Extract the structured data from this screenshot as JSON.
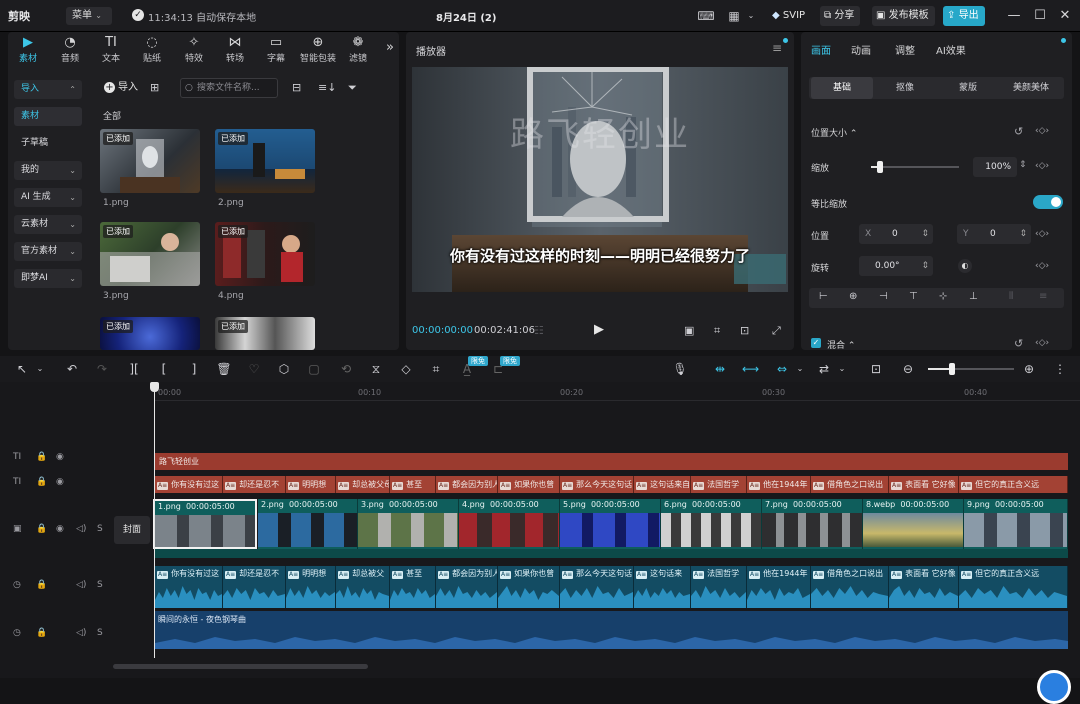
{
  "app": {
    "logo": "剪映",
    "menu_label": "菜单",
    "save_status": "11:34:13 自动保存本地",
    "doc_title": "8月24日 (2)"
  },
  "titlebar": {
    "svip": "SVIP",
    "share": "分享",
    "publish_template": "发布模板",
    "export": "导出"
  },
  "media_tabs": [
    "素材",
    "音频",
    "文本",
    "贴纸",
    "特效",
    "转场",
    "字幕",
    "智能包装",
    "滤镜"
  ],
  "side_nav": [
    {
      "label": "导入",
      "chevron": "⌃"
    },
    {
      "label": "素材"
    },
    {
      "label": "子草稿"
    },
    {
      "label": "我的",
      "chevron": "⌄"
    },
    {
      "label": "AI 生成",
      "chevron": "⌄"
    },
    {
      "label": "云素材",
      "chevron": "⌄"
    },
    {
      "label": "官方素材",
      "chevron": "⌄"
    },
    {
      "label": "即梦AI",
      "chevron": "⌄"
    }
  ],
  "media": {
    "import_label": "导入",
    "search_placeholder": "搜索文件名称...",
    "section": "全部",
    "added_badge": "已添加",
    "thumbs": [
      "1.png",
      "2.png",
      "3.png",
      "4.png"
    ]
  },
  "player": {
    "title": "播放器",
    "watermark": "路飞轻创业",
    "subtitle": "你有没有过这样的时刻——明明已经很努力了",
    "time_current": "00:00:00:00",
    "time_total": "00:02:41:06"
  },
  "props": {
    "tabs": [
      "画面",
      "动画",
      "调整",
      "AI效果"
    ],
    "sub_tabs": [
      "基础",
      "抠像",
      "蒙版",
      "美颜美体"
    ],
    "section_position": "位置大小",
    "scale_label": "缩放",
    "scale_value": "100%",
    "scale_fraction": 0.1,
    "lock_ratio_label": "等比缩放",
    "position_label": "位置",
    "pos_x_label": "X",
    "pos_x": "0",
    "pos_y_label": "Y",
    "pos_y": "0",
    "rotate_label": "旋转",
    "rotate_value": "0.00°",
    "blend_label": "混合"
  },
  "timeline": {
    "free_badges": [
      "限免",
      "限免"
    ],
    "ruler": [
      "00:00",
      "00:10",
      "00:20",
      "00:30",
      "00:40"
    ],
    "title_track": "路飞轻创业",
    "cover_label": "封面",
    "subtitles": [
      "你有没有过这",
      "却还是忍不",
      "明明想",
      "却总被父母",
      "甚至",
      "都会因为别人",
      "如果你也曾",
      "那么今天这句话",
      "这句话来自",
      "法国哲学",
      "他在1944年",
      "借角色之口说出",
      "表面看 它好像",
      "但它的真正含义远"
    ],
    "clips": [
      {
        "name": "1.png",
        "dur": "00:00:05:00"
      },
      {
        "name": "2.png",
        "dur": "00:00:05:00"
      },
      {
        "name": "3.png",
        "dur": "00:00:05:00"
      },
      {
        "name": "4.png",
        "dur": "00:00:05:00"
      },
      {
        "name": "5.png",
        "dur": "00:00:05:00"
      },
      {
        "name": "6.png",
        "dur": "00:00:05:00"
      },
      {
        "name": "7.png",
        "dur": "00:00:05:00"
      },
      {
        "name": "8.webp",
        "dur": "00:00:05:00"
      },
      {
        "name": "9.png",
        "dur": "00:00:05:00"
      }
    ],
    "audio_segments": [
      "你有没有过这",
      "却还是忍不",
      "明明想",
      "却总被父",
      "甚至",
      "都会因为别人",
      "如果你也曾",
      "那么今天这句话",
      "这句话来",
      "法国哲学",
      "他在1944年",
      "借角色之口说出",
      "表面看 它好像",
      "但它的真正含义远"
    ],
    "music": "瞬间的永恒 - 夜色钢琴曲",
    "track_lock": "S"
  }
}
